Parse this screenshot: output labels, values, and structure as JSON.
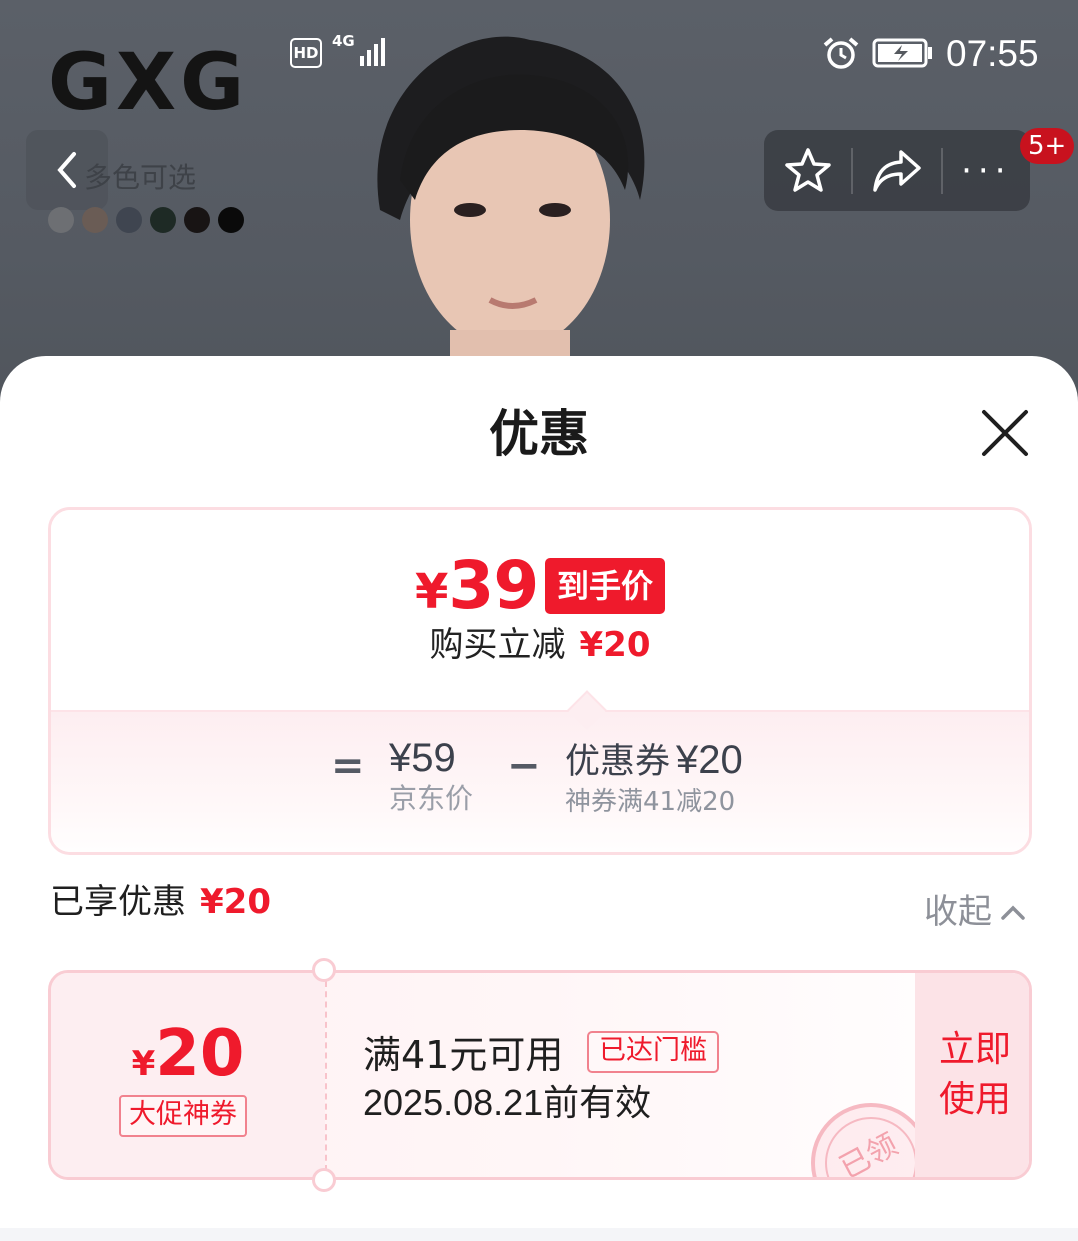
{
  "status_bar": {
    "hd": "HD",
    "network": "4G",
    "time": "07:55"
  },
  "product_header": {
    "brand_logo": "GXG",
    "color_option_label": "多色可选",
    "swatch_colors": [
      "#6d6f73",
      "#6a5c55",
      "#3f4550",
      "#1e2a25",
      "#181414",
      "#0a0a0a"
    ],
    "notification_badge": "5+"
  },
  "sheet": {
    "title": "优惠"
  },
  "price_summary": {
    "final_currency": "¥",
    "final_price": "39",
    "final_tag": "到手价",
    "instant_cut_label": "购买立减",
    "instant_cut_amount": "¥20",
    "equals": "=",
    "jd_price": "¥59",
    "jd_price_label": "京东价",
    "minus": "−",
    "coupon_label": "优惠券",
    "coupon_value": "¥20",
    "coupon_sub": "神券满41减20"
  },
  "enjoyed": {
    "label": "已享优惠",
    "amount": "¥20",
    "collapse_label": "收起"
  },
  "coupon": {
    "currency": "¥",
    "amount": "20",
    "type": "大促神券",
    "condition": "满41元可用",
    "threshold_badge": "已达门槛",
    "expiry": "2025.08.21前有效",
    "use_line1": "立即",
    "use_line2": "使用",
    "stamp": "已领"
  },
  "colors": {
    "accent_red": "#ef1a2c",
    "coupon_border": "#f9ccd3"
  }
}
